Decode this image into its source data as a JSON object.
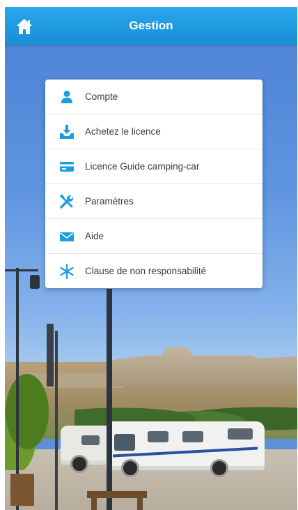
{
  "header": {
    "title": "Gestion",
    "home_icon": "home-icon"
  },
  "menu": {
    "items": [
      {
        "label": "Compte",
        "icon": "user-icon"
      },
      {
        "label": "Achetez le licence",
        "icon": "download-tray-icon"
      },
      {
        "label": "Licence Guide camping-car",
        "icon": "card-icon"
      },
      {
        "label": "Paramètres",
        "icon": "tools-icon"
      },
      {
        "label": "Aide",
        "icon": "envelope-icon"
      },
      {
        "label": "Clause de non responsabilité",
        "icon": "asterisk-icon"
      }
    ]
  },
  "colors": {
    "accent": "#1e9ce2",
    "header": "#2aa6ea",
    "text": "#3a3a3a"
  }
}
